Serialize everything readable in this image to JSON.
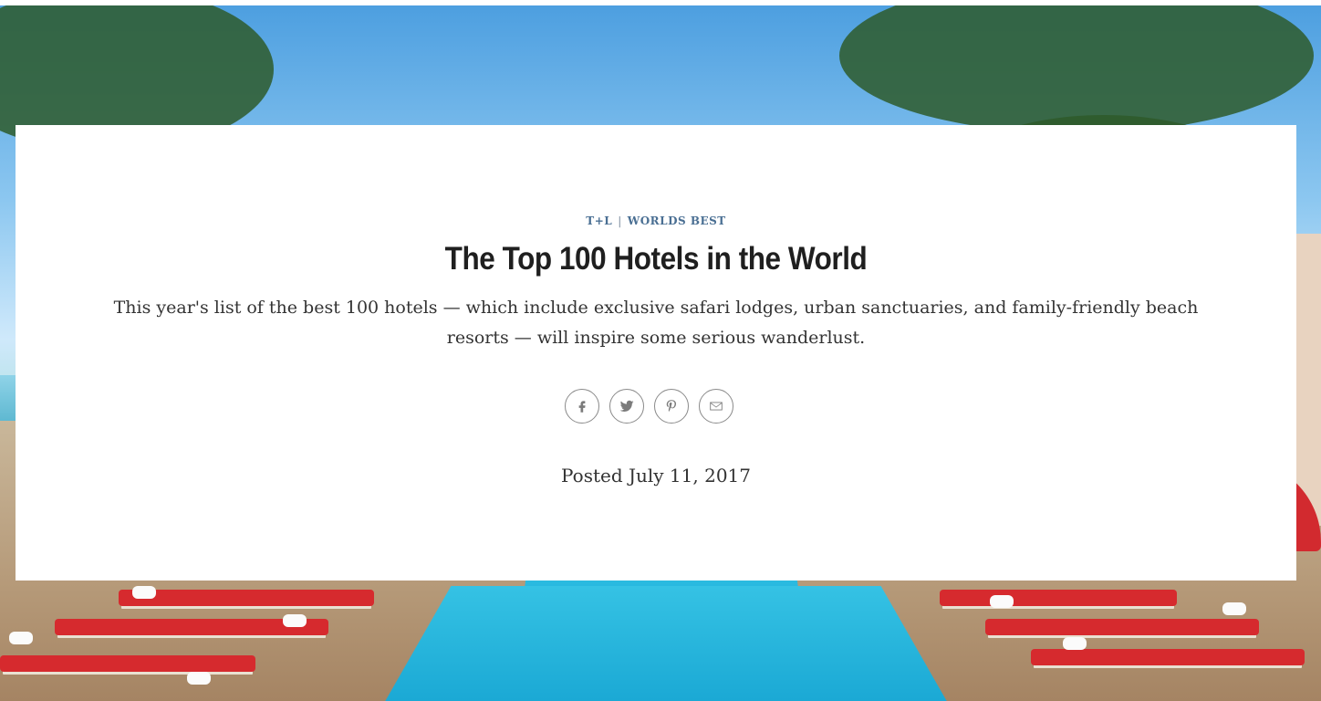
{
  "article": {
    "brand": "T+L",
    "section": "WORLDS BEST",
    "title": "The Top 100 Hotels in the World",
    "dek": "This year's list of the best 100 hotels — which include exclusive safari lodges, urban sanctuaries, and family-friendly beach resorts — will inspire some serious wanderlust.",
    "posted": "Posted July 11, 2017"
  },
  "share": {
    "icons": [
      "facebook-icon",
      "twitter-icon",
      "pinterest-icon",
      "email-icon"
    ]
  },
  "colors": {
    "eyebrow": "#4a6f93",
    "title": "#1f1f1f",
    "body": "#333333",
    "icon": "#7b7b7b"
  }
}
